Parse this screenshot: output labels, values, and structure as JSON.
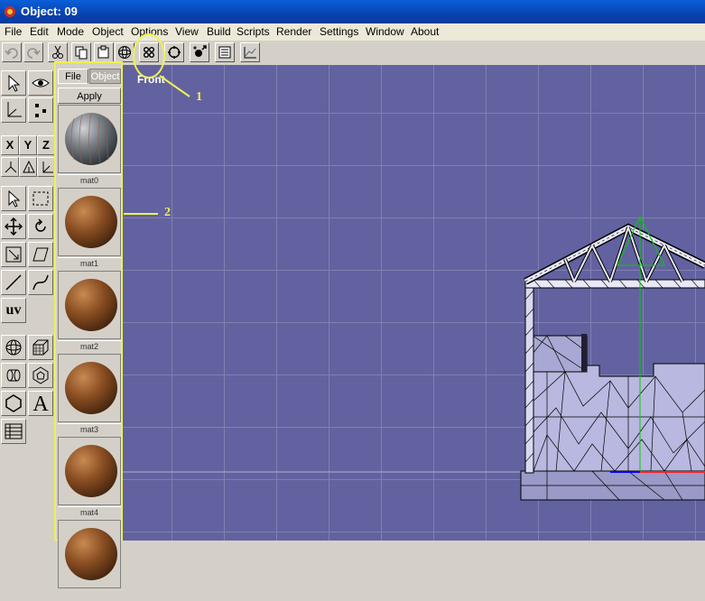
{
  "window": {
    "title": "Object: 09"
  },
  "menu": [
    "File",
    "Edit",
    "Mode",
    "Object",
    "Options",
    "View",
    "Build",
    "Scripts",
    "Render",
    "Settings",
    "Window",
    "About"
  ],
  "toolbar": {
    "buttons": [
      "undo-icon",
      "redo-icon",
      "cut-icon",
      "copy-icon",
      "paste-icon",
      "sphere-icon",
      "four-views-icon",
      "rotate-view-icon",
      "add-light-icon",
      "list-icon",
      "graph-icon"
    ]
  },
  "tools": {
    "axis_labels": [
      "X",
      "Y",
      "Z"
    ],
    "uv_label": "uv",
    "text_label": "A"
  },
  "materials_panel": {
    "tabs": [
      "File",
      "Object"
    ],
    "apply_label": "Apply",
    "items": [
      {
        "name": "mat0"
      },
      {
        "name": "mat1"
      },
      {
        "name": "mat2"
      },
      {
        "name": "mat3"
      },
      {
        "name": "mat4"
      }
    ]
  },
  "viewport": {
    "view_label": "Front"
  },
  "annotations": {
    "callout_1": "1",
    "callout_2": "2"
  },
  "colors": {
    "viewport_bg": "#6262a0",
    "grid": "#8080b4",
    "highlight": "#f0f050",
    "axis_y": "#00d000"
  }
}
